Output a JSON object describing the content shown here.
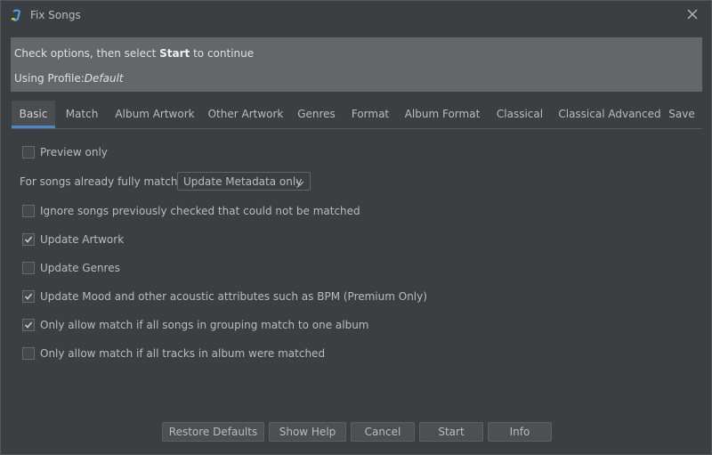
{
  "window": {
    "title": "Fix Songs"
  },
  "info": {
    "line1_pre": "Check options, then select ",
    "line1_bold": "Start",
    "line1_post": " to continue",
    "line2_pre": "Using Profile:",
    "line2_profile": "Default"
  },
  "tabs": [
    {
      "label": "Basic",
      "active": true
    },
    {
      "label": "Match",
      "active": false
    },
    {
      "label": "Album Artwork",
      "active": false
    },
    {
      "label": "Other Artwork",
      "active": false
    },
    {
      "label": "Genres",
      "active": false
    },
    {
      "label": "Format",
      "active": false
    },
    {
      "label": "Album Format",
      "active": false
    },
    {
      "label": "Classical",
      "active": false
    },
    {
      "label": "Classical Advanced",
      "active": false
    },
    {
      "label": "Save",
      "active": false
    }
  ],
  "options": {
    "preview_only": {
      "label": "Preview only",
      "checked": false
    },
    "fully_matched": {
      "label": "For songs already fully matched",
      "value": "Update Metadata only"
    },
    "ignore_previously": {
      "label": "Ignore songs previously checked that could not be matched",
      "checked": false
    },
    "update_artwork": {
      "label": "Update Artwork",
      "checked": true
    },
    "update_genres": {
      "label": "Update Genres",
      "checked": false
    },
    "update_mood": {
      "label": "Update Mood and other acoustic attributes such as BPM (Premium Only)",
      "checked": true
    },
    "grouping_match": {
      "label": "Only allow match if all songs in grouping match to one album",
      "checked": true
    },
    "all_tracks_matched": {
      "label": "Only allow match if all tracks in album were matched",
      "checked": false
    }
  },
  "buttons": {
    "restore_defaults": "Restore Defaults",
    "show_help": "Show Help",
    "cancel": "Cancel",
    "start": "Start",
    "info": "Info"
  },
  "colors": {
    "background": "#3c3f41",
    "info_panel": "#646668",
    "active_tab_underline": "#4a88c7",
    "text": "#bbbbbb",
    "app_icon_blue": "#3fa9f5",
    "app_icon_yellow": "#f5c518"
  },
  "icons": {
    "app": "music-note-icon",
    "close": "close-icon",
    "combo_arrow": "chevron-down-icon",
    "check": "check-icon"
  }
}
